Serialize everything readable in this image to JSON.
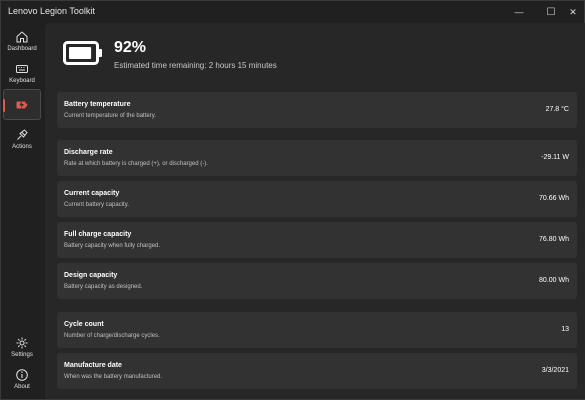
{
  "app": {
    "title": "Lenovo Legion Toolkit"
  },
  "window_controls": {
    "minimize": "—",
    "maximize": "☐",
    "close": "✕"
  },
  "sidebar": {
    "items": [
      {
        "label": "Dashboard",
        "icon": "home-icon"
      },
      {
        "label": "Keyboard",
        "icon": "keyboard-icon"
      },
      {
        "label": "",
        "icon": "battery-icon",
        "active": true
      },
      {
        "label": "Actions",
        "icon": "actions-icon"
      },
      {
        "label": "Settings",
        "icon": "gear-icon"
      },
      {
        "label": "About",
        "icon": "info-icon"
      }
    ]
  },
  "battery": {
    "percent": "92%",
    "level": 0.92,
    "estimate": "Estimated time remaining: 2 hours 15 minutes"
  },
  "cards": [
    {
      "title": "Battery temperature",
      "desc": "Current temperature of the battery.",
      "value": "27.8 °C"
    },
    {
      "title": "Discharge rate",
      "desc": "Rate at which battery is charged (+), or discharged (-).",
      "value": "-29.11 W"
    },
    {
      "title": "Current capacity",
      "desc": "Current battery capacity.",
      "value": "70.66 Wh"
    },
    {
      "title": "Full charge capacity",
      "desc": "Battery capacity when fully charged.",
      "value": "76.80 Wh"
    },
    {
      "title": "Design capacity",
      "desc": "Battery capacity as designed.",
      "value": "80.00 Wh"
    },
    {
      "title": "Cycle count",
      "desc": "Number of charge/discharge cycles.",
      "value": "13"
    },
    {
      "title": "Manufacture date",
      "desc": "When was the battery manufactured.",
      "value": "3/3/2021"
    }
  ],
  "colors": {
    "accent": "#e05a4f",
    "background": "#202020",
    "card": "#323232"
  }
}
